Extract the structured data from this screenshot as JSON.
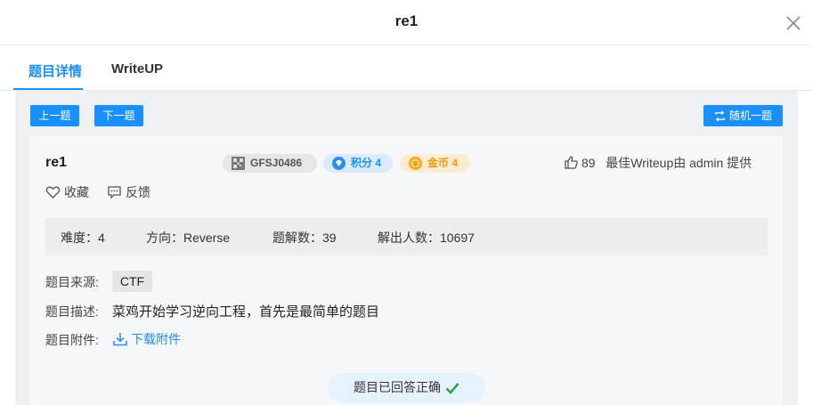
{
  "modal": {
    "title": "re1"
  },
  "tabs": [
    {
      "label": "题目详情",
      "active": true
    },
    {
      "label": "WriteUP",
      "active": false
    }
  ],
  "toolbar": {
    "prev_label": "上一题",
    "next_label": "下一题",
    "random_label": "随机一题"
  },
  "task": {
    "name": "re1",
    "id_tag": "GFSJ0486",
    "score_tag": "积分 4",
    "coin_tag": "金币 4",
    "likes": "89",
    "writeup_credit": "最佳Writeup由 admin 提供",
    "favorite_label": "收藏",
    "feedback_label": "反馈",
    "stats": {
      "difficulty": "难度：4",
      "direction": "方向：Reverse",
      "solves": "题解数：39",
      "solvers": "解出人数：10697"
    },
    "source_label": "题目来源:",
    "source_value": "CTF",
    "description_label": "题目描述:",
    "description_value": "菜鸡开始学习逆向工程，首先是最简单的题目",
    "attachment_label": "题目附件:",
    "download_label": "下载附件",
    "status": "题目已回答正确"
  },
  "colors": {
    "accent": "#1890ff",
    "success": "#27a844",
    "coin": "#f59a0a",
    "panel": "#eef0f4"
  },
  "icons": [
    "close-icon",
    "shuffle-icon",
    "qr-icon",
    "diamond-icon",
    "coin-icon",
    "thumbs-up-icon",
    "heart-icon",
    "feedback-icon",
    "download-icon",
    "check-icon"
  ]
}
